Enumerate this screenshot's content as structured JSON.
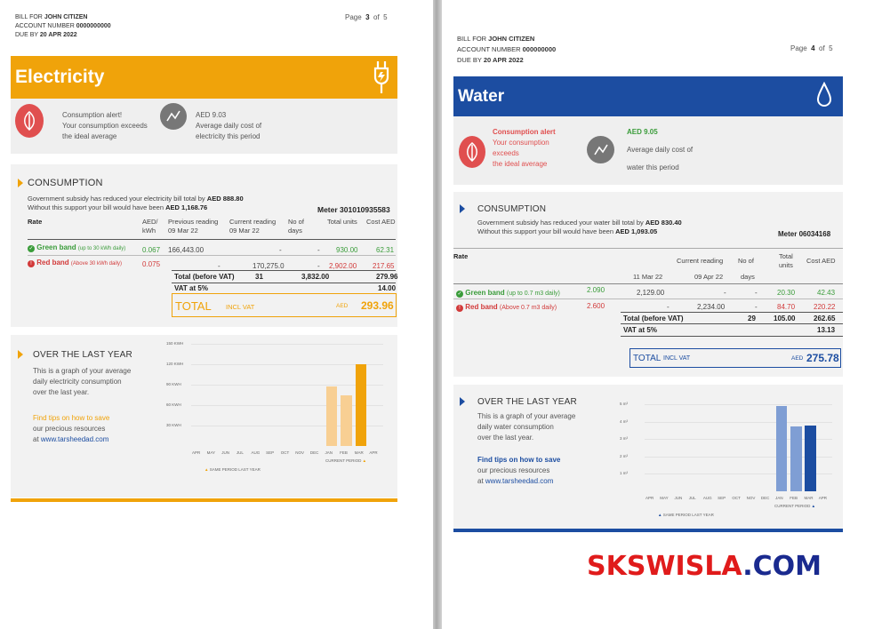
{
  "left": {
    "bill_for_label": "BILL FOR",
    "bill_for_name": "JOHN CITIZEN",
    "account_label": "ACCOUNT NUMBER",
    "account_number": "0000000000",
    "due_label": "DUE BY",
    "due_date": "20 APR 2022",
    "page_label": "Page",
    "page_current": "3",
    "page_of": "of",
    "page_total": "5",
    "band_title": "Electricity",
    "band_color": "#f0a30a",
    "alert_line1": "Consumption alert!",
    "alert_line2": "Your consumption exceeds",
    "alert_line3": "the ideal average",
    "avg_amount": "AED 9.03",
    "avg_line1": "Average daily cost of",
    "avg_line2": "electricity this period",
    "consumption_title": "CONSUMPTION",
    "subsidy_text": "Government subsidy has reduced your electricity bill total by",
    "subsidy_amount": "AED 888.80",
    "without_text": "Without this support your bill would have been",
    "without_amount": "AED 1,168.76",
    "meter": "Meter 301010935583",
    "col_rate": "Rate",
    "col_aed_kwh_1": "AED/",
    "col_aed_kwh_2": "kWh",
    "col_prev_1": "Previous reading",
    "col_prev_2": "09 Mar 22",
    "col_curr_1": "Current reading",
    "col_curr_2": "09 Mar 22",
    "col_days_1": "No of",
    "col_days_2": "days",
    "col_units": "Total units",
    "col_cost": "Cost AED",
    "green_label": "Green band",
    "green_range": "(up to 30 kWh daily)",
    "green_rate": "0.067",
    "green_prev": "166,443.00",
    "green_curr": "-",
    "green_days": "-",
    "green_units": "930.00",
    "green_cost": "62.31",
    "red_label": "Red band",
    "red_range": "(Above 30 kWh daily)",
    "red_rate": "0.075",
    "red_prev": "-",
    "red_curr": "170,275.0",
    "red_days": "-",
    "red_units": "2,902.00",
    "red_cost": "217.65",
    "total_label": "Total (before VAT)",
    "total_days": "31",
    "total_units": "3,832.00",
    "total_cost": "279.96",
    "vat_label": "VAT at 5%",
    "vat_amount": "14.00",
    "grand_label": "TOTAL",
    "grand_incl": "INCL VAT",
    "grand_currency": "AED",
    "grand_amount": "293.96",
    "year_title": "OVER THE LAST YEAR",
    "year_line1": "This is a graph of your average",
    "year_line2": "daily electricity consumption",
    "year_line3": "over the last year.",
    "tips_title": "Find tips on how to save",
    "tips_line": "our precious resources",
    "tips_at": "at",
    "tips_url": "www.tarsheedad.com",
    "legend_same": "SAME PERIOD LAST YEAR",
    "legend_current": "CURRENT PERIOD"
  },
  "right": {
    "bill_for_label": "BILL FOR",
    "bill_for_name": "JOHN CITIZEN",
    "account_label": "ACCOUNT NUMBER",
    "account_number": "000000000",
    "due_label": "DUE BY",
    "due_date": "20 APR 2022",
    "page_label": "Page",
    "page_current": "4",
    "page_of": "of",
    "page_total": "5",
    "band_title": "Water",
    "band_color": "#1c4da1",
    "alert_line1": "Consumption alert",
    "alert_line2": "Your consumption",
    "alert_line3": "exceeds",
    "alert_line4": "the ideal average",
    "avg_amount": "AED 9.05",
    "avg_line1": "Average daily cost of",
    "avg_line2": "water this period",
    "consumption_title": "CONSUMPTION",
    "subsidy_text": "Government subsidy has reduced your water bill total by",
    "subsidy_amount": "AED 830.40",
    "without_text": "Without this support your bill would have been",
    "without_amount": "AED 1,093.05",
    "meter": "Meter 06034168",
    "col_rate": "Rate",
    "col_prev_2": "11 Mar 22",
    "col_curr_1": "Current reading",
    "col_curr_2": "09 Apr 22",
    "col_days_1": "No of",
    "col_days_2": "days",
    "col_units_1": "Total",
    "col_units_2": "units",
    "col_cost": "Cost AED",
    "green_label": "Green band",
    "green_range": "(up to 0.7 m3 daily)",
    "green_rate": "2.090",
    "green_prev": "2,129.00",
    "green_curr": "-",
    "green_days": "-",
    "green_units": "20.30",
    "green_cost": "42.43",
    "red_label": "Red band",
    "red_range": "(Above 0.7 m3 daily)",
    "red_rate": "2.600",
    "red_prev": "-",
    "red_curr": "2,234.00",
    "red_days": "-",
    "red_units": "84.70",
    "red_cost": "220.22",
    "total_label": "Total (before VAT)",
    "total_days": "29",
    "total_units": "105.00",
    "total_cost": "262.65",
    "vat_label": "VAT at 5%",
    "vat_amount": "13.13",
    "grand_label": "TOTAL",
    "grand_incl": "INCL VAT",
    "grand_currency": "AED",
    "grand_amount": "275.78",
    "year_title": "OVER THE LAST YEAR",
    "year_line1": "This is a graph of your average",
    "year_line2": "daily water consumption",
    "year_line3": "over the last year.",
    "tips_title": "Find tips on how to save",
    "tips_line": "our precious resources",
    "tips_at": "at",
    "tips_url": "www.tarsheedad.com",
    "legend_same": "SAME PERIOD LAST YEAR",
    "legend_current": "CURRENT PERIOD"
  },
  "watermark": {
    "part1": "SKSWISLA",
    "part2": ".COM",
    "color1": "#e01b1b",
    "color2": "#1a2a8f"
  },
  "chart_data": [
    {
      "type": "bar",
      "categories": [
        "APR",
        "MAY",
        "JUN",
        "JUL",
        "AUG",
        "SEP",
        "OCT",
        "NOV",
        "DEC",
        "JAN",
        "FEB",
        "MAR",
        "APR"
      ],
      "values": [
        null,
        null,
        null,
        null,
        null,
        null,
        null,
        null,
        null,
        88,
        75,
        120,
        null
      ],
      "y_ticks": [
        "150 KWH",
        "120 KWH",
        "90 KWH",
        "60 KWH",
        "30 KWH"
      ],
      "ylim": [
        0,
        150
      ],
      "color": "#f0a30a",
      "colors": [
        "#f8cf93",
        "#f8cf93",
        "#f0a30a"
      ]
    },
    {
      "type": "bar",
      "categories": [
        "APR",
        "MAY",
        "JUN",
        "JUL",
        "AUG",
        "SEP",
        "OCT",
        "NOV",
        "DEC",
        "JAN",
        "FEB",
        "MAR",
        "APR"
      ],
      "values": [
        null,
        null,
        null,
        null,
        null,
        null,
        null,
        null,
        null,
        4.9,
        3.7,
        3.8,
        null
      ],
      "y_ticks": [
        "5 m³",
        "4 m³",
        "3 m³",
        "2 m³",
        "1 m³"
      ],
      "ylim": [
        0,
        5
      ],
      "color": "#1c4da1",
      "colors": [
        "#7f9ed4",
        "#7f9ed4",
        "#1c4da1"
      ]
    }
  ]
}
